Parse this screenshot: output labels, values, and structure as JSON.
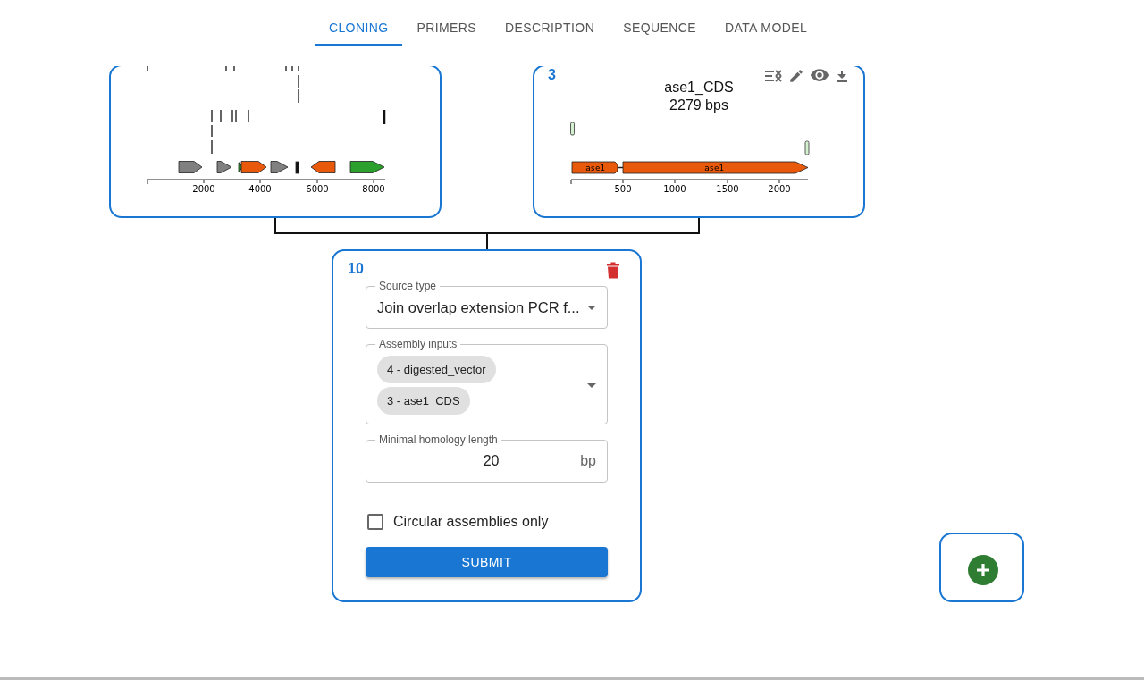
{
  "tabs": [
    {
      "label": "CLONING",
      "selected": true
    },
    {
      "label": "PRIMERS",
      "selected": false
    },
    {
      "label": "DESCRIPTION",
      "selected": false
    },
    {
      "label": "SEQUENCE",
      "selected": false
    },
    {
      "label": "DATA MODEL",
      "selected": false
    }
  ],
  "left_sequence_card": {
    "ticks": [
      "2000",
      "4000",
      "6000",
      "8000"
    ]
  },
  "right_sequence_card": {
    "number": "3",
    "name": "ase1_CDS",
    "length": "2279 bps",
    "feature_labels": [
      "ase1",
      "ase1"
    ],
    "ticks": [
      "500",
      "1000",
      "1500",
      "2000"
    ]
  },
  "source_card": {
    "number": "10",
    "source_type": {
      "label": "Source type",
      "value": "Join overlap extension PCR f..."
    },
    "assembly_inputs": {
      "label": "Assembly inputs",
      "chips": [
        "4 - digested_vector",
        "3 - ase1_CDS"
      ]
    },
    "homology": {
      "label": "Minimal homology length",
      "value": "20",
      "unit": "bp"
    },
    "circular": {
      "label": "Circular assemblies only",
      "checked": false
    },
    "submit": "SUBMIT"
  }
}
